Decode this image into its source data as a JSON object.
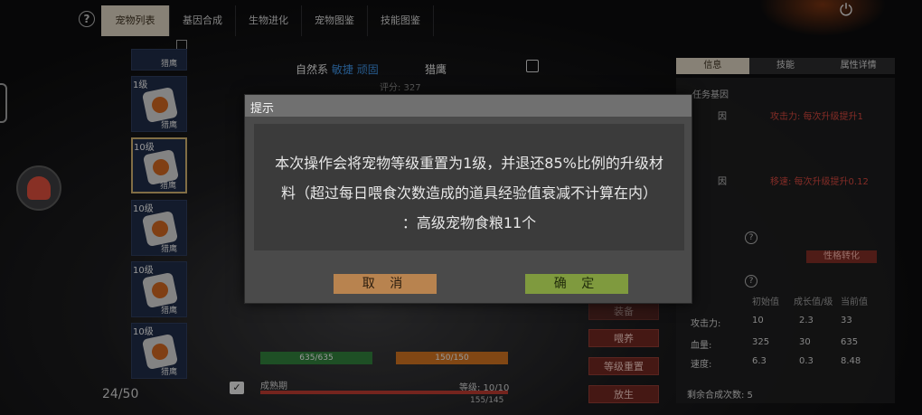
{
  "tabs": [
    "宠物列表",
    "基因合成",
    "生物进化",
    "宠物图鉴",
    "技能图鉴"
  ],
  "pets": [
    {
      "level": "",
      "name": "猎鹰"
    },
    {
      "level": "1级",
      "name": "猎鹰"
    },
    {
      "level": "10级",
      "name": "猎鹰"
    },
    {
      "level": "10级",
      "name": "猎鹰"
    },
    {
      "level": "10级",
      "name": "猎鹰"
    },
    {
      "level": "10级",
      "name": "猎鹰"
    }
  ],
  "pet_count": "24/50",
  "detail": {
    "attr_prefix": "自然系",
    "attr_highlight": "敏捷",
    "attr_suffix": "顽固",
    "title": "猎鹰",
    "score": "评分:  327"
  },
  "right_tabs": [
    "信息",
    "技能",
    "属性详情"
  ],
  "right_panel": {
    "section": "任务基因",
    "row1_left": "因",
    "row1_right": "攻击力: 每次升级提升1",
    "row2_left": "因",
    "row2_right": "移速: 每次升级提升0.12",
    "trait_button": "性格转化"
  },
  "stats": {
    "headers": [
      "初始值",
      "成长值/级",
      "当前值"
    ],
    "rows": [
      {
        "label": "攻击力:",
        "base": "10",
        "growth": "2.3",
        "current": "33"
      },
      {
        "label": "血量:",
        "base": "325",
        "growth": "30",
        "current": "635"
      },
      {
        "label": "速度:",
        "base": "6.3",
        "growth": "0.3",
        "current": "8.48"
      }
    ],
    "remaining": "剩余合成次数: 5"
  },
  "actions": [
    "喂养",
    "等级重置",
    "放生"
  ],
  "partial_button": "装备",
  "bars": {
    "hp": "635/635",
    "hunger": "150/150",
    "growth_label": "成熟期",
    "level": "等级:  10/10",
    "exp": "155/145"
  },
  "dialog": {
    "title": "提示",
    "lines": [
      "本次操作会将宠物等级重置为1级，并退还85%比例的升级材",
      "料（超过每日喂食次数造成的道具经验值衰减不计算在内）",
      "：高级宠物食粮11个"
    ],
    "cancel": "取 消",
    "ok": "确 定"
  }
}
